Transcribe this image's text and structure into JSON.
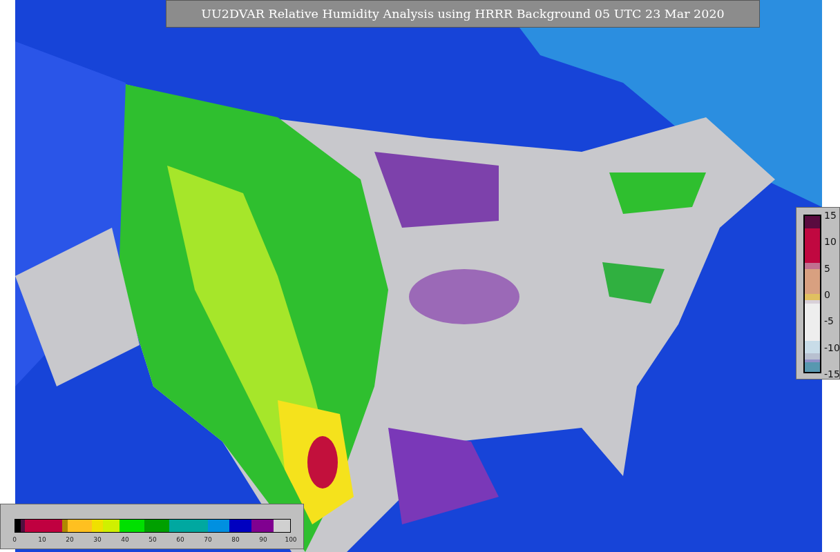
{
  "title": "UU2DVAR Relative Humidity Analysis using HRRR Background 05 UTC 23 Mar 2020",
  "difference_legend": {
    "ticks": [
      "15",
      "10",
      "5",
      "0",
      "-5",
      "-10",
      "-15"
    ]
  },
  "humidity_legend": {
    "ticks": [
      "0",
      "10",
      "20",
      "30",
      "40",
      "50",
      "60",
      "70",
      "80",
      "90",
      "100"
    ]
  }
}
